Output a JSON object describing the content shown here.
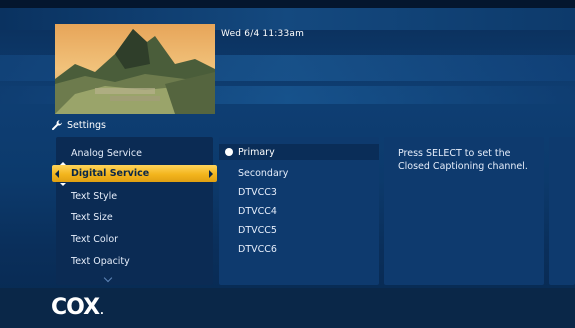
{
  "header": {
    "datetime": "Wed 6/4  11:33am"
  },
  "thumbnail": {
    "icon": "mountain-landscape"
  },
  "section": {
    "title": "Settings",
    "icon": "wrench-icon"
  },
  "menu": {
    "items": [
      "Analog Service",
      "Digital Service",
      "Text Style",
      "Text Size",
      "Text Color",
      "Text Opacity"
    ],
    "selected_index": 1
  },
  "options": {
    "items": [
      "Primary",
      "Secondary",
      "DTVCC3",
      "DTVCC4",
      "DTVCC5",
      "DTVCC6"
    ],
    "selected_index": 0
  },
  "help": {
    "text": "Press SELECT to set the Closed Captioning channel."
  },
  "brand": {
    "logo": "COX",
    "logo_suffix": "."
  },
  "colors": {
    "highlight": "#f3b51d",
    "panel": "#0e3a6e",
    "background": "#0c3a6c"
  }
}
